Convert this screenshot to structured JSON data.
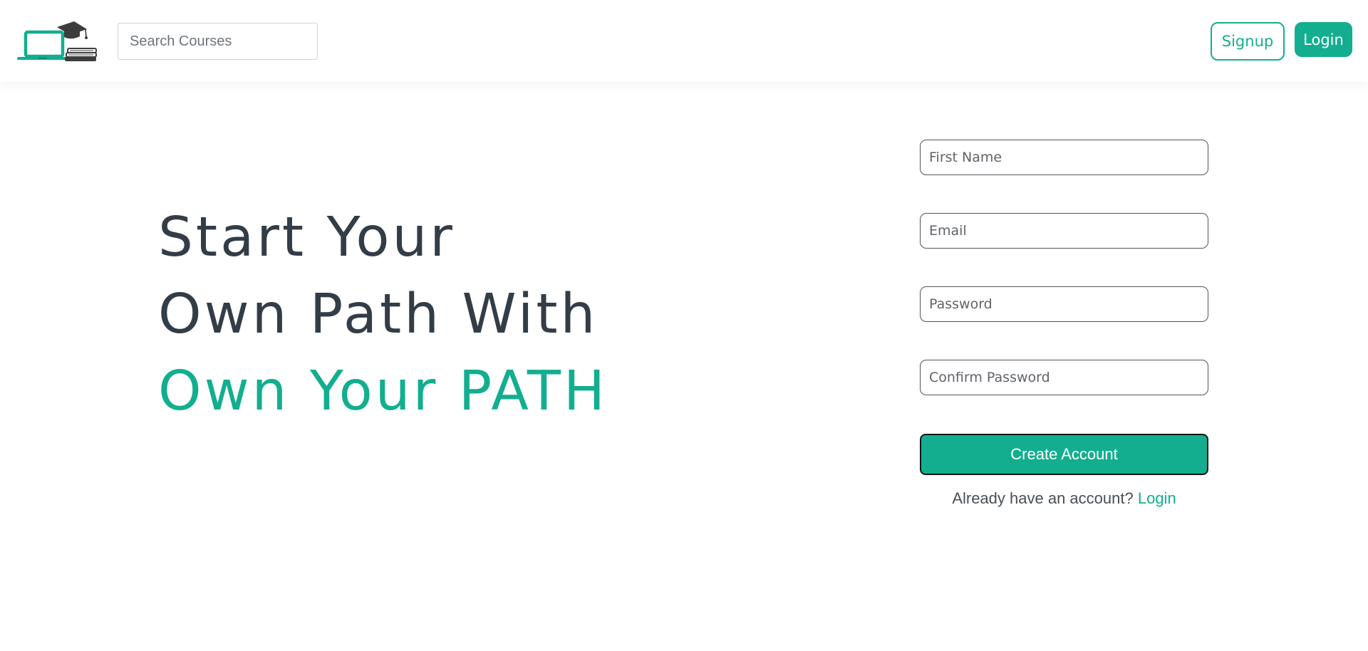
{
  "header": {
    "search_placeholder": "Search Courses",
    "signup_label": "Signup",
    "login_label": "Login"
  },
  "hero": {
    "line1": "Start Your",
    "line2": "Own Path With",
    "line3": "Own Your PATH"
  },
  "form": {
    "first_name_placeholder": "First Name",
    "email_placeholder": "Email",
    "password_placeholder": "Password",
    "confirm_password_placeholder": "Confirm Password",
    "create_account_label": "Create Account",
    "already_text": "Already have an account?",
    "login_link": "Login"
  },
  "colors": {
    "accent": "#12ae8f",
    "heading": "#333d48",
    "logo_dark": "#3d3d3d"
  },
  "icons": {
    "logo": "laptop-graduation-cap-books-icon"
  }
}
